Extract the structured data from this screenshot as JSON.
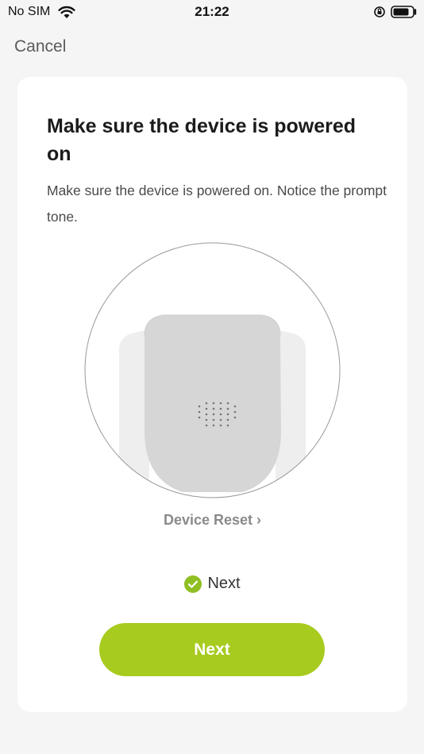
{
  "status_bar": {
    "carrier": "No SIM",
    "time": "21:22",
    "icons": [
      "wifi-icon",
      "orientation-lock-icon",
      "battery-icon"
    ]
  },
  "nav": {
    "cancel_label": "Cancel"
  },
  "content": {
    "title": "Make sure the device is powered on",
    "description": "Make sure the device is powered on. Notice the prompt tone.",
    "device_reset_label": "Device Reset",
    "confirm_label": "Next",
    "confirm_checked": true,
    "next_button_label": "Next"
  },
  "colors": {
    "accent": "#a7cb1f",
    "check": "#8fbf22",
    "background": "#f5f5f6",
    "card": "#ffffff"
  }
}
